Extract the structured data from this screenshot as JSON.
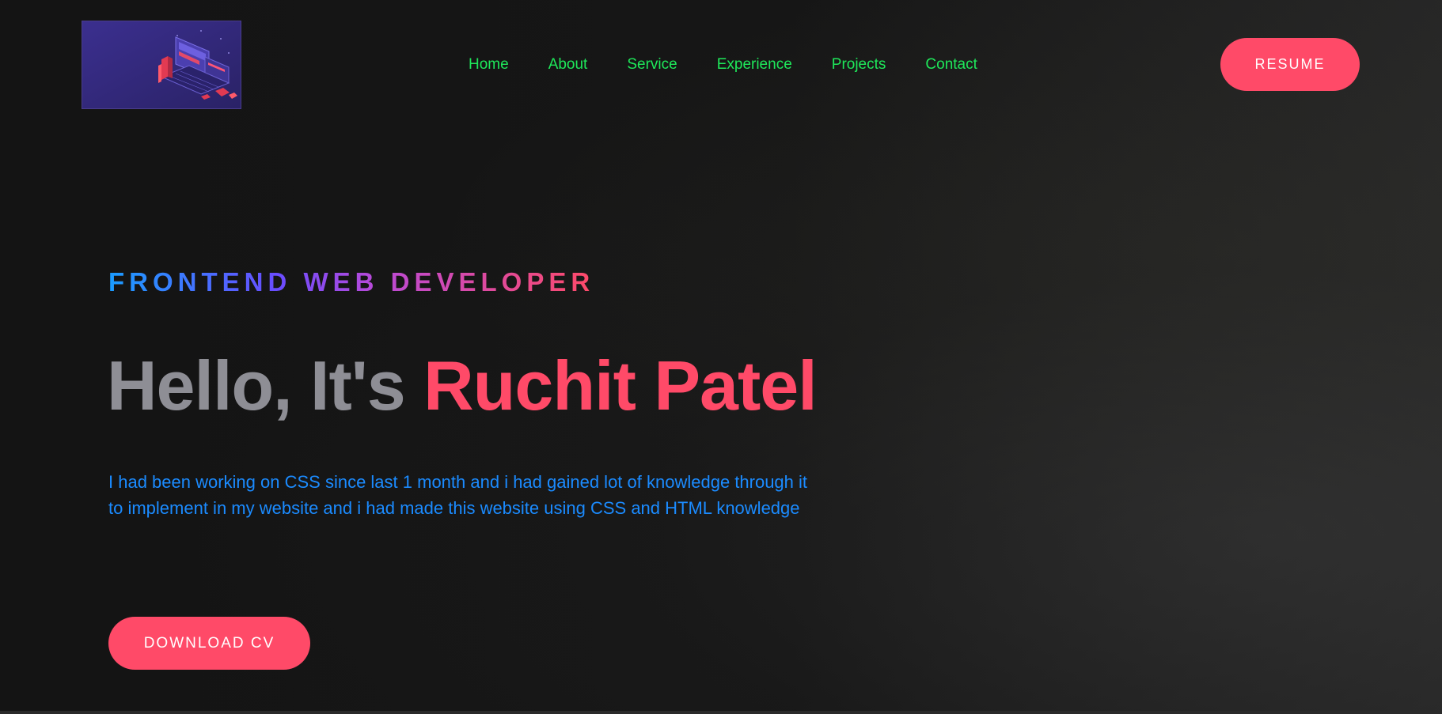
{
  "nav": {
    "items": [
      {
        "label": "Home"
      },
      {
        "label": "About"
      },
      {
        "label": "Service"
      },
      {
        "label": "Experience"
      },
      {
        "label": "Projects"
      },
      {
        "label": "Contact"
      }
    ],
    "resume_label": "RESUME"
  },
  "hero": {
    "subtitle": "FRONTEND WEB DEVELOPER",
    "greeting": "Hello, It's",
    "name": "Ruchit Patel",
    "description": "I had been working on CSS since last 1 month and i had gained lot of knowledge through it to implement in my website and i had made this website using CSS and HTML knowledge",
    "cta_label": "DOWNLOAD CV"
  },
  "colors": {
    "accent": "#ff4a68",
    "nav_text": "#1ee85a",
    "description_text": "#1b8bff",
    "greeting_text": "#8e8e95",
    "background": "#151515"
  },
  "icons": {
    "logo": "isometric-laptop-illustration"
  }
}
